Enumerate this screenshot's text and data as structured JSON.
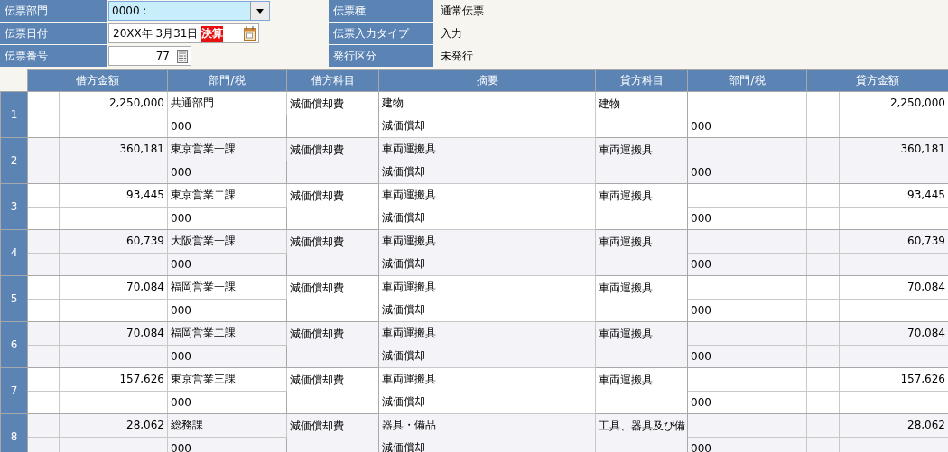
{
  "form": {
    "left": [
      {
        "label": "伝票部門",
        "kind": "dropdown",
        "value": "0000 :",
        "focused": true
      },
      {
        "label": "伝票日付",
        "kind": "date",
        "value": "20XX年 3月31日",
        "badge": "決算"
      },
      {
        "label": "伝票番号",
        "kind": "number",
        "value": "77"
      }
    ],
    "right": [
      {
        "label": "伝票種",
        "value": "通常伝票"
      },
      {
        "label": "伝票入力タイプ",
        "value": "入力"
      },
      {
        "label": "発行区分",
        "value": "未発行"
      }
    ]
  },
  "table": {
    "columns": [
      "借方金額",
      "部門/税",
      "借方科目",
      "摘要",
      "貸方科目",
      "部門/税",
      "貸方金額"
    ],
    "rows": [
      {
        "number": "1",
        "debit_amount": "2,250,000",
        "department": "共通部門",
        "department_code": "000",
        "debit_account": "減価償却費",
        "summary": "建物",
        "summary_note": "減価償却",
        "credit_account": "建物",
        "credit_department_code": "000",
        "credit_amount": "2,250,000"
      },
      {
        "number": "2",
        "debit_amount": "360,181",
        "department": "東京営業一課",
        "department_code": "000",
        "debit_account": "減価償却費",
        "summary": "車両運搬具",
        "summary_note": "減価償却",
        "credit_account": "車両運搬具",
        "credit_department_code": "000",
        "credit_amount": "360,181"
      },
      {
        "number": "3",
        "debit_amount": "93,445",
        "department": "東京営業二課",
        "department_code": "000",
        "debit_account": "減価償却費",
        "summary": "車両運搬具",
        "summary_note": "減価償却",
        "credit_account": "車両運搬具",
        "credit_department_code": "000",
        "credit_amount": "93,445"
      },
      {
        "number": "4",
        "debit_amount": "60,739",
        "department": "大阪営業一課",
        "department_code": "000",
        "debit_account": "減価償却費",
        "summary": "車両運搬具",
        "summary_note": "減価償却",
        "credit_account": "車両運搬具",
        "credit_department_code": "000",
        "credit_amount": "60,739"
      },
      {
        "number": "5",
        "debit_amount": "70,084",
        "department": "福岡営業一課",
        "department_code": "000",
        "debit_account": "減価償却費",
        "summary": "車両運搬具",
        "summary_note": "減価償却",
        "credit_account": "車両運搬具",
        "credit_department_code": "000",
        "credit_amount": "70,084"
      },
      {
        "number": "6",
        "debit_amount": "70,084",
        "department": "福岡営業二課",
        "department_code": "000",
        "debit_account": "減価償却費",
        "summary": "車両運搬具",
        "summary_note": "減価償却",
        "credit_account": "車両運搬具",
        "credit_department_code": "000",
        "credit_amount": "70,084"
      },
      {
        "number": "7",
        "debit_amount": "157,626",
        "department": "東京営業三課",
        "department_code": "000",
        "debit_account": "減価償却費",
        "summary": "車両運搬具",
        "summary_note": "減価償却",
        "credit_account": "車両運搬具",
        "credit_department_code": "000",
        "credit_amount": "157,626"
      },
      {
        "number": "8",
        "debit_amount": "28,062",
        "department": "総務課",
        "department_code": "000",
        "debit_account": "減価償却費",
        "summary": "器具・備品",
        "summary_note": "減価償却",
        "credit_account": "工具、器具及び備",
        "credit_department_code": "000",
        "credit_amount": "28,062"
      }
    ]
  }
}
